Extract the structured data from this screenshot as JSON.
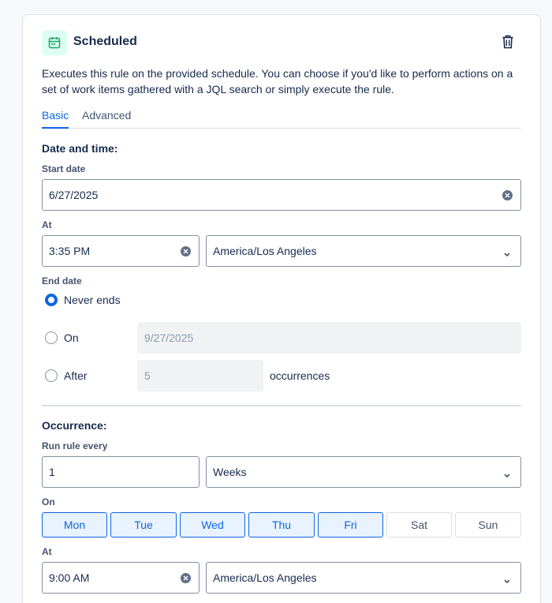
{
  "trigger": {
    "title": "Scheduled",
    "description": "Executes this rule on the provided schedule. You can choose if you'd like to perform actions on a set of work items gathered with a JQL search or simply execute the rule."
  },
  "tabs": [
    {
      "label": "Basic",
      "active": true
    },
    {
      "label": "Advanced",
      "active": false
    }
  ],
  "date_time": {
    "heading": "Date and time:",
    "start_date_label": "Start date",
    "start_date_value": "6/27/2025",
    "at_label": "At",
    "at_time_value": "3:35 PM",
    "timezone_value": "America/Los Angeles",
    "end_date_label": "End date",
    "end_options": {
      "never_label": "Never ends",
      "on_label": "On",
      "on_date_value": "9/27/2025",
      "after_label": "After",
      "after_count_value": "5",
      "occurrences_label": "occurrences",
      "selected": "never"
    }
  },
  "occurrence": {
    "heading": "Occurrence:",
    "run_every_label": "Run rule every",
    "run_every_value": "1",
    "unit_value": "Weeks",
    "on_label": "On",
    "days": [
      {
        "label": "Mon",
        "selected": true
      },
      {
        "label": "Tue",
        "selected": true
      },
      {
        "label": "Wed",
        "selected": true
      },
      {
        "label": "Thu",
        "selected": true
      },
      {
        "label": "Fri",
        "selected": true
      },
      {
        "label": "Sat",
        "selected": false
      },
      {
        "label": "Sun",
        "selected": false
      }
    ],
    "at_label": "At",
    "at_time_value": "9:00 AM",
    "timezone_value": "America/Los Angeles"
  },
  "colors": {
    "accent": "#0c66e4",
    "icon_bg": "#dcfff1",
    "icon_fg": "#22a06b"
  }
}
